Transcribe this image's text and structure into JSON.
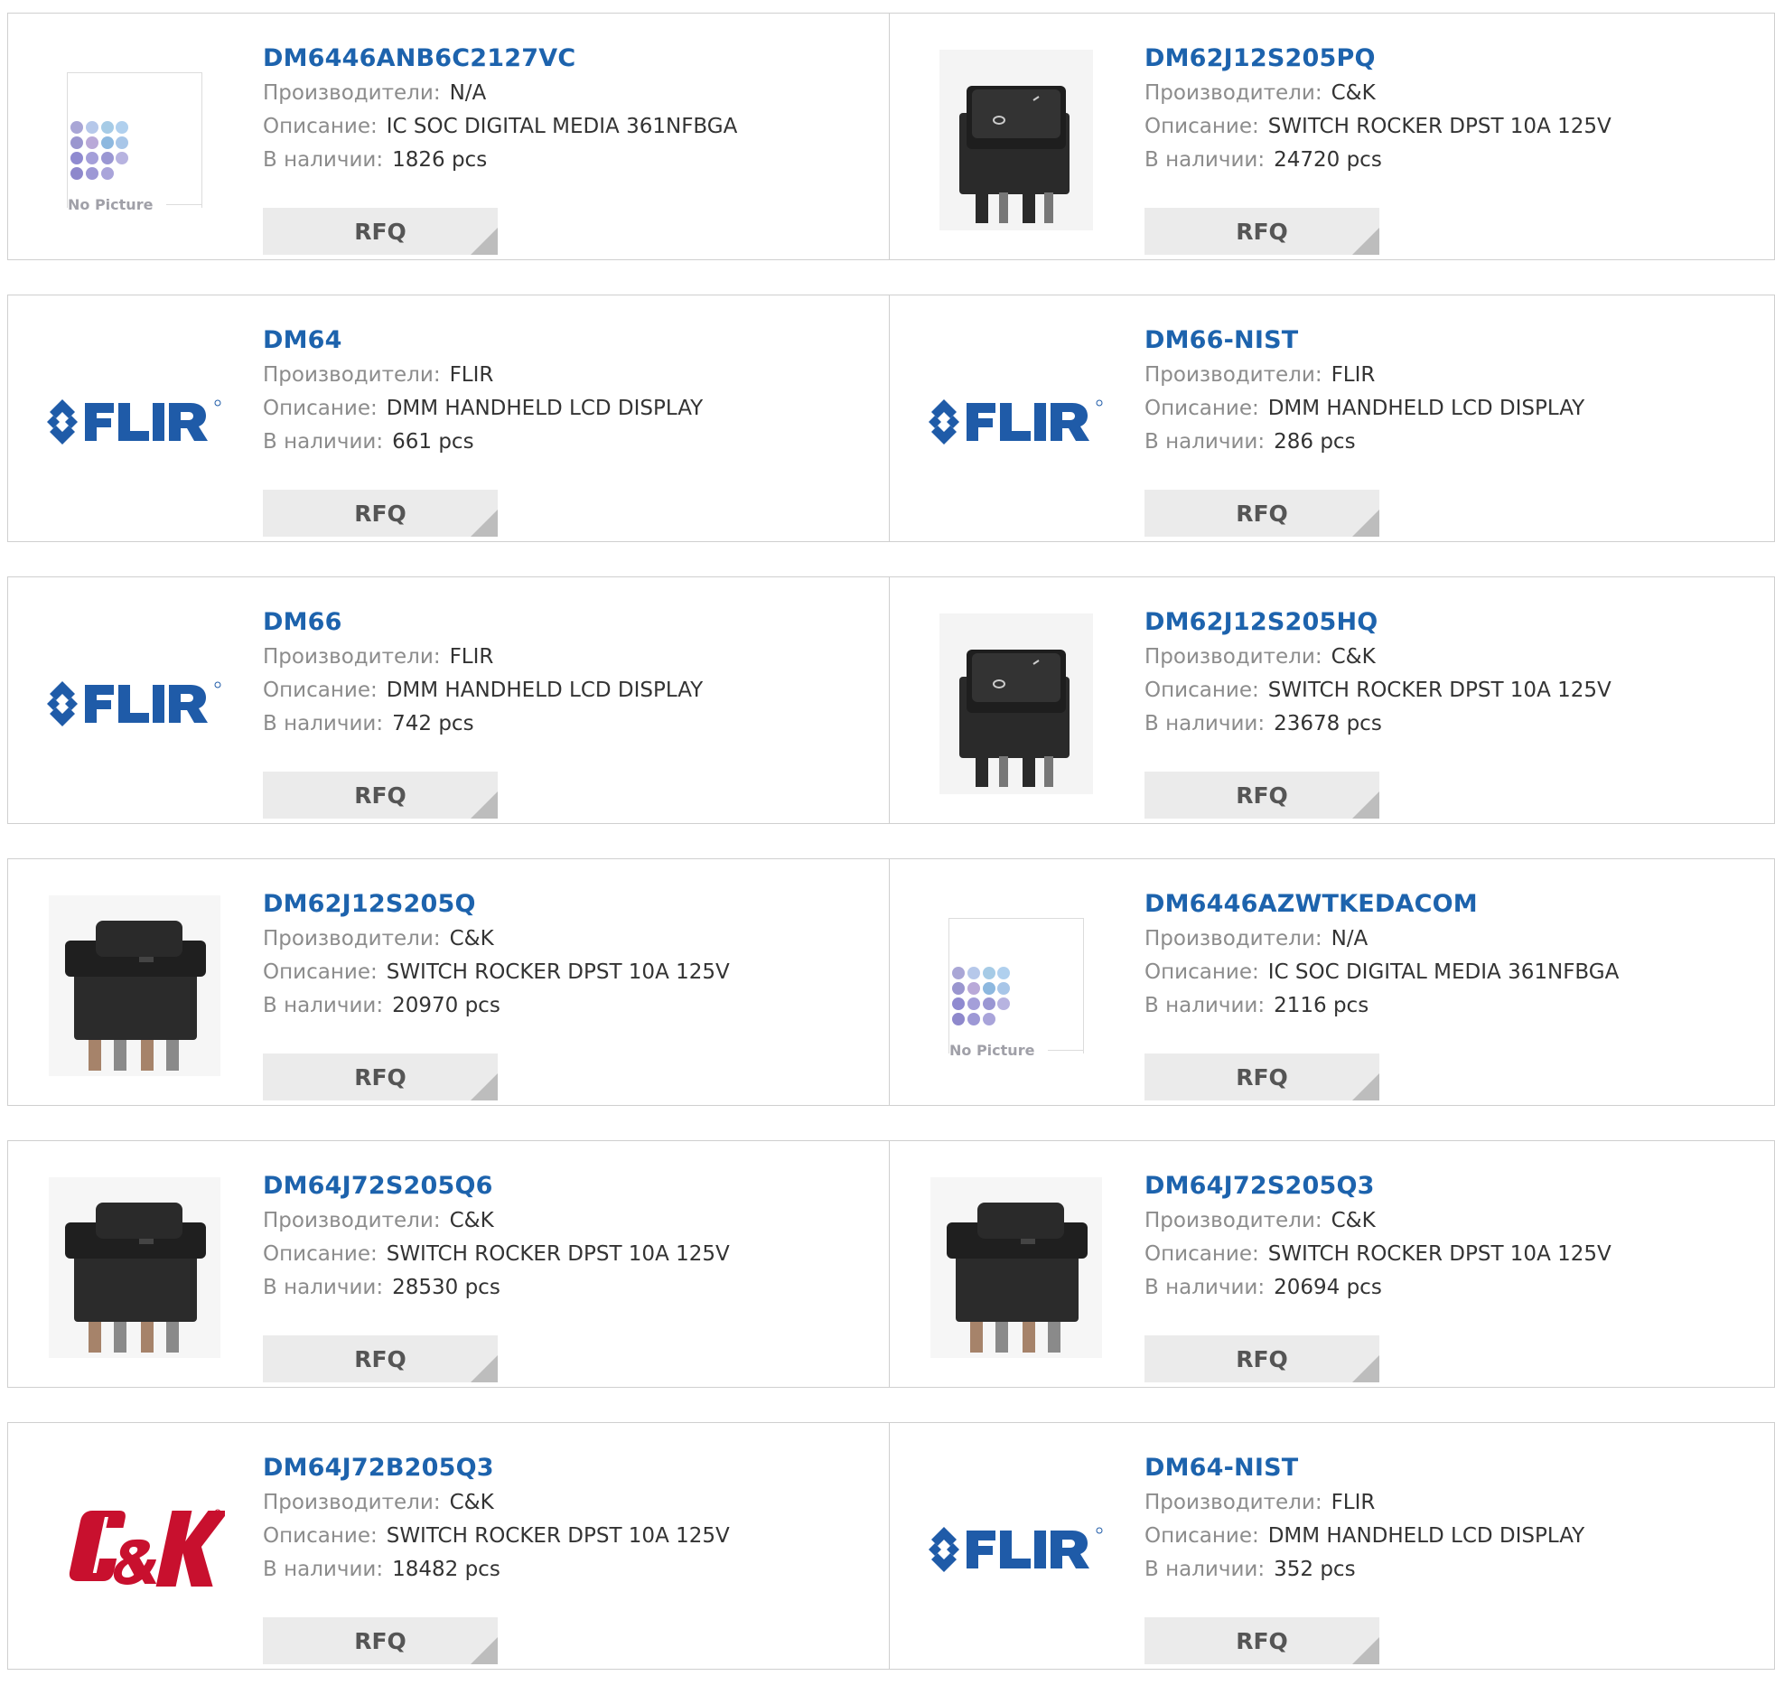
{
  "labels": {
    "manufacturer": "Производители:",
    "description": "Описание:",
    "stock": "В наличии:",
    "rfq": "RFQ",
    "no_picture": "No Picture"
  },
  "products": [
    {
      "pn": "DM6446ANB6C2127VC",
      "manufacturer": "N/A",
      "description": "IC SOC DIGITAL MEDIA 361NFBGA",
      "stock": "1826 pcs",
      "image": "no-picture"
    },
    {
      "pn": "DM62J12S205PQ",
      "manufacturer": "C&K",
      "description": "SWITCH ROCKER DPST 10A 125V",
      "stock": "24720 pcs",
      "image": "rocker-switch-small"
    },
    {
      "pn": "DM64",
      "manufacturer": "FLIR",
      "description": "DMM HANDHELD LCD DISPLAY",
      "stock": "661 pcs",
      "image": "flir-logo"
    },
    {
      "pn": "DM66-NIST",
      "manufacturer": "FLIR",
      "description": "DMM HANDHELD LCD DISPLAY",
      "stock": "286 pcs",
      "image": "flir-logo"
    },
    {
      "pn": "DM66",
      "manufacturer": "FLIR",
      "description": "DMM HANDHELD LCD DISPLAY",
      "stock": "742 pcs",
      "image": "flir-logo"
    },
    {
      "pn": "DM62J12S205HQ",
      "manufacturer": "C&K",
      "description": "SWITCH ROCKER DPST 10A 125V",
      "stock": "23678 pcs",
      "image": "rocker-switch-small"
    },
    {
      "pn": "DM62J12S205Q",
      "manufacturer": "C&K",
      "description": "SWITCH ROCKER DPST 10A 125V",
      "stock": "20970 pcs",
      "image": "rocker-switch-large"
    },
    {
      "pn": "DM6446AZWTKEDACOM",
      "manufacturer": "N/A",
      "description": "IC SOC DIGITAL MEDIA 361NFBGA",
      "stock": "2116 pcs",
      "image": "no-picture"
    },
    {
      "pn": "DM64J72S205Q6",
      "manufacturer": "C&K",
      "description": "SWITCH ROCKER DPST 10A 125V",
      "stock": "28530 pcs",
      "image": "rocker-switch-large"
    },
    {
      "pn": "DM64J72S205Q3",
      "manufacturer": "C&K",
      "description": "SWITCH ROCKER DPST 10A 125V",
      "stock": "20694 pcs",
      "image": "rocker-switch-large"
    },
    {
      "pn": "DM64J72B205Q3",
      "manufacturer": "C&K",
      "description": "SWITCH ROCKER DPST 10A 125V",
      "stock": "18482 pcs",
      "image": "ck-logo"
    },
    {
      "pn": "DM64-NIST",
      "manufacturer": "FLIR",
      "description": "DMM HANDHELD LCD DISPLAY",
      "stock": "352 pcs",
      "image": "flir-logo"
    }
  ],
  "colors": {
    "link": "#1d63ad",
    "label": "#8c8c8c",
    "value": "#333333",
    "button_bg": "#ebebeb",
    "flir_blue": "#1f5ba8",
    "ck_red": "#c8102e"
  }
}
